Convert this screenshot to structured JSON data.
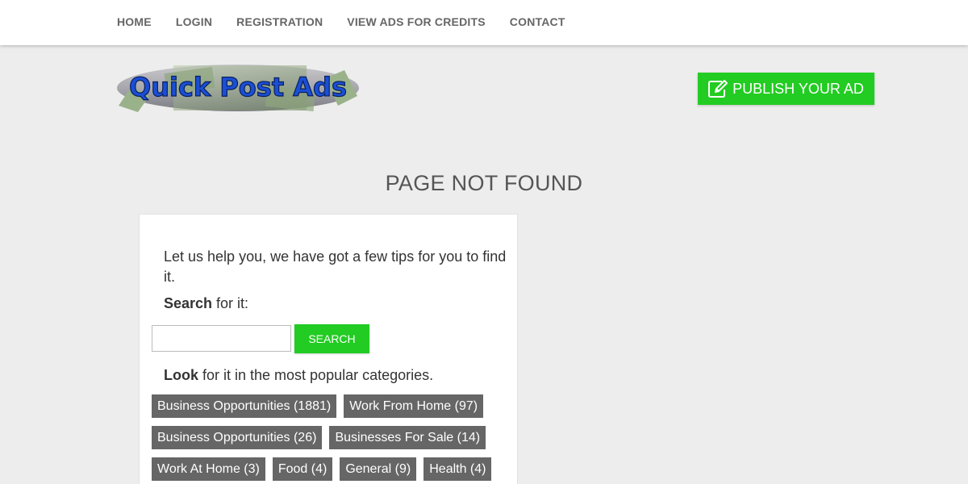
{
  "nav": {
    "items": [
      {
        "label": "HOME"
      },
      {
        "label": "LOGIN"
      },
      {
        "label": "REGISTRATION"
      },
      {
        "label": "VIEW ADS FOR CREDITS"
      },
      {
        "label": "CONTACT"
      }
    ]
  },
  "logo": {
    "text": "Quick Post Ads"
  },
  "header": {
    "publish_label": "PUBLISH YOUR AD"
  },
  "page": {
    "title": "PAGE NOT FOUND"
  },
  "card": {
    "tips": "Let us help you, we have got a few tips for you to find it.",
    "search_bold": "Search",
    "search_rest": " for it:",
    "search_button": "SEARCH",
    "search_value": "",
    "look_bold": "Look",
    "look_rest": " for it in the most popular categories."
  },
  "categories": [
    {
      "label": "Business Opportunities (1881)"
    },
    {
      "label": "Work From Home (97)"
    },
    {
      "label": "Business Opportunities (26)"
    },
    {
      "label": "Businesses For Sale (14)"
    },
    {
      "label": "Work At Home (3)"
    },
    {
      "label": "Food (4)"
    },
    {
      "label": "General (9)"
    },
    {
      "label": "Health (4)"
    }
  ],
  "colors": {
    "accent_green": "#22cc22",
    "category_bg": "#666666",
    "page_bg": "#ededed"
  },
  "icons": {
    "publish": "pencil-square-icon"
  }
}
